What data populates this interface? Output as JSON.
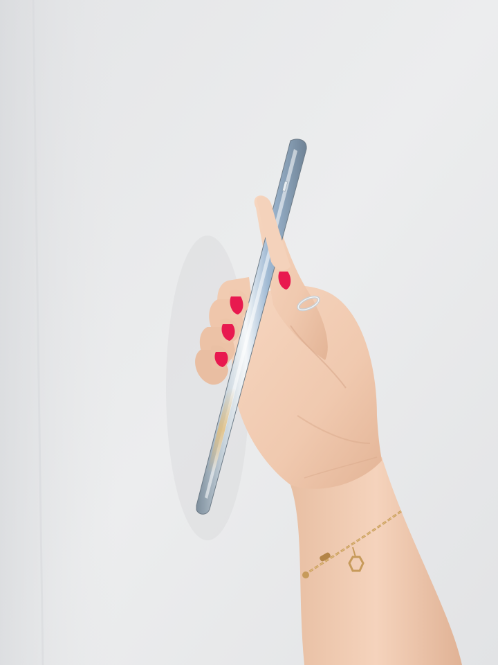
{
  "scene": {
    "subject": "hand-holding-phone-side-profile",
    "colors": {
      "wall_light": "#e9eaeb",
      "wall_mid": "#dedfe1",
      "wall_shadow": "#cfd1d4",
      "skin": "#f2cdb4",
      "skin_shadow": "#d9a98c",
      "skin_highlight": "#f8dcc8",
      "nail_polish": "#e8194f",
      "phone_silver_light": "#eef2f5",
      "phone_silver_mid": "#b9c4cc",
      "phone_blue": "#8fb0cf",
      "phone_gold_reflection": "#d8b06a",
      "ring_silver": "#c9ced3",
      "bracelet_gold": "#c79a5a"
    },
    "elements": {
      "wall": "plain-white-wall",
      "phone": "smartphone-side-view",
      "hand": "left-hand",
      "ring": "silver-ring",
      "bracelet": "gold-chain-bracelet",
      "charm": "hexagon-charm"
    }
  }
}
